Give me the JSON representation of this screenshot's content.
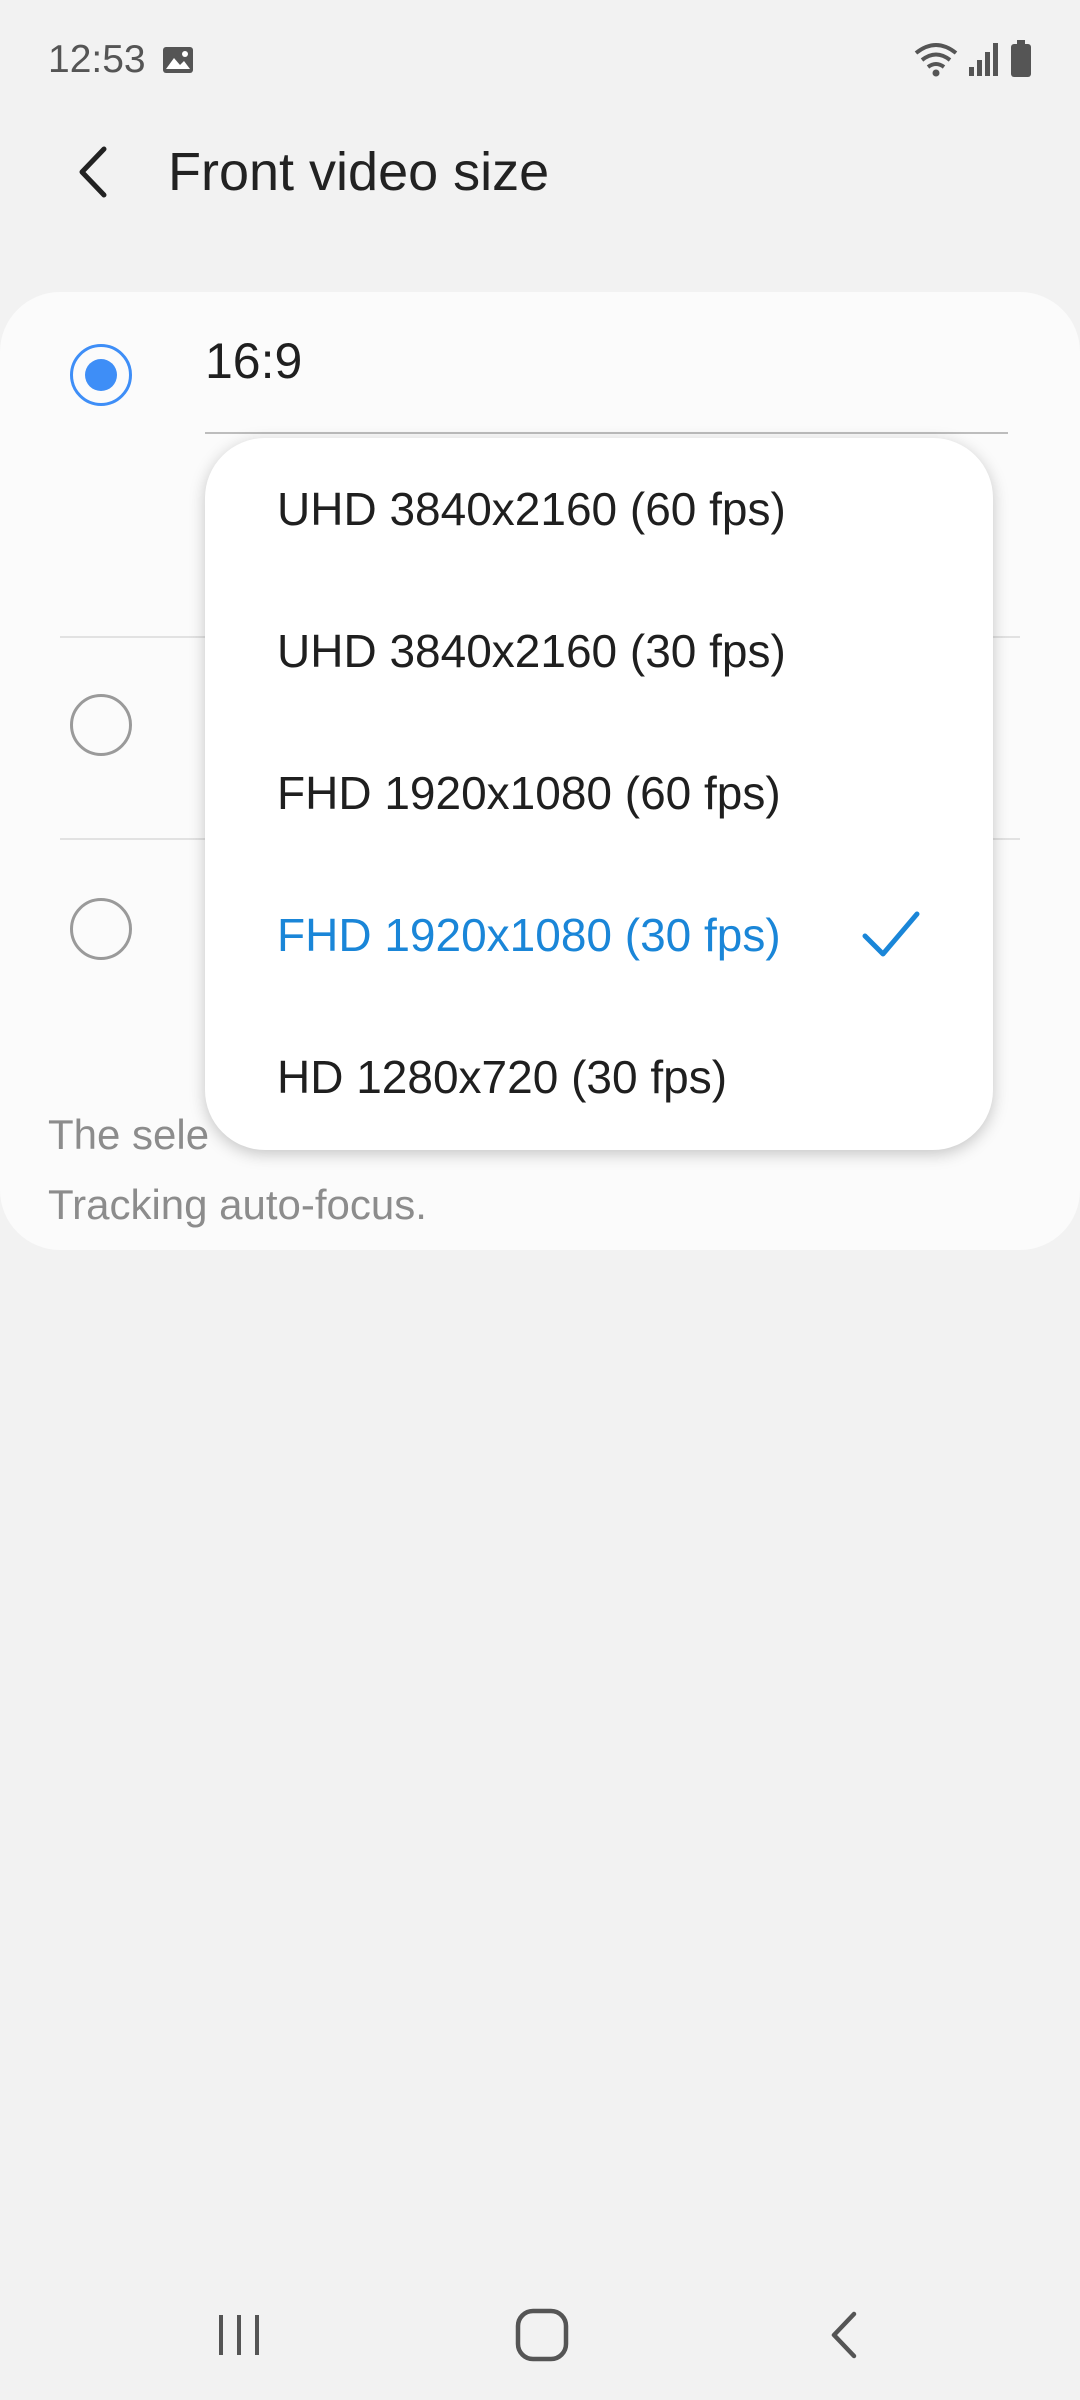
{
  "status_bar": {
    "time": "12:53",
    "icons": [
      "image-notification-icon",
      "wifi-icon",
      "signal-icon",
      "battery-icon"
    ]
  },
  "header": {
    "title": "Front video size",
    "back_icon": "back-arrow-icon"
  },
  "card": {
    "options": [
      {
        "label": "16:9",
        "checked": true
      },
      {
        "label": "",
        "checked": false
      },
      {
        "label": "",
        "checked": false
      }
    ],
    "note": "The sele… Tracking auto-focus.",
    "note_line1": "The sele",
    "note_line2": "Tracking auto-focus."
  },
  "dropdown": {
    "items": [
      {
        "label": "UHD 3840x2160 (60 fps)",
        "selected": false
      },
      {
        "label": "UHD 3840x2160 (30 fps)",
        "selected": false
      },
      {
        "label": "FHD 1920x1080 (60 fps)",
        "selected": false
      },
      {
        "label": "FHD 1920x1080 (30 fps)",
        "selected": true
      },
      {
        "label": "HD 1280x720 (30 fps)",
        "selected": false
      }
    ]
  },
  "nav_bar": {
    "buttons": [
      "recent-apps-icon",
      "home-icon",
      "back-icon"
    ]
  },
  "colors": {
    "accent": "#3e8ef7",
    "selected_text": "#1a86d8",
    "background": "#f2f2f2",
    "card": "#fbfbfb"
  }
}
